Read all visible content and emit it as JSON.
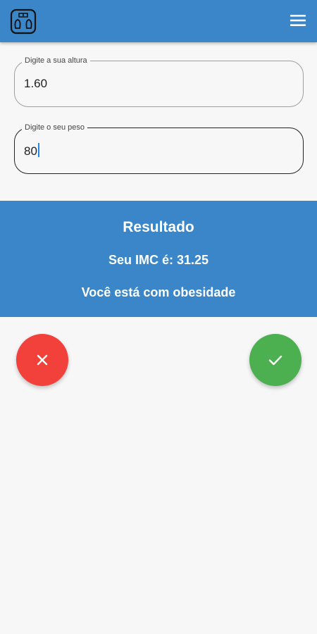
{
  "appbar": {
    "logo_icon": "scale-icon",
    "menu_icon": "menu-icon"
  },
  "height_field": {
    "label": "Digite a sua altura",
    "value": "1.60"
  },
  "weight_field": {
    "label": "Digite o seu peso",
    "value": "80"
  },
  "result": {
    "title": "Resultado",
    "imc_text": "Seu IMC é: 31.25",
    "status_text": "Você está com obesidade"
  },
  "actions": {
    "clear_icon": "close-icon",
    "confirm_icon": "check-icon"
  },
  "colors": {
    "primary": "#3a86c8",
    "clear": "#f2403b",
    "confirm": "#4caf50",
    "background": "#f7f7f7"
  }
}
